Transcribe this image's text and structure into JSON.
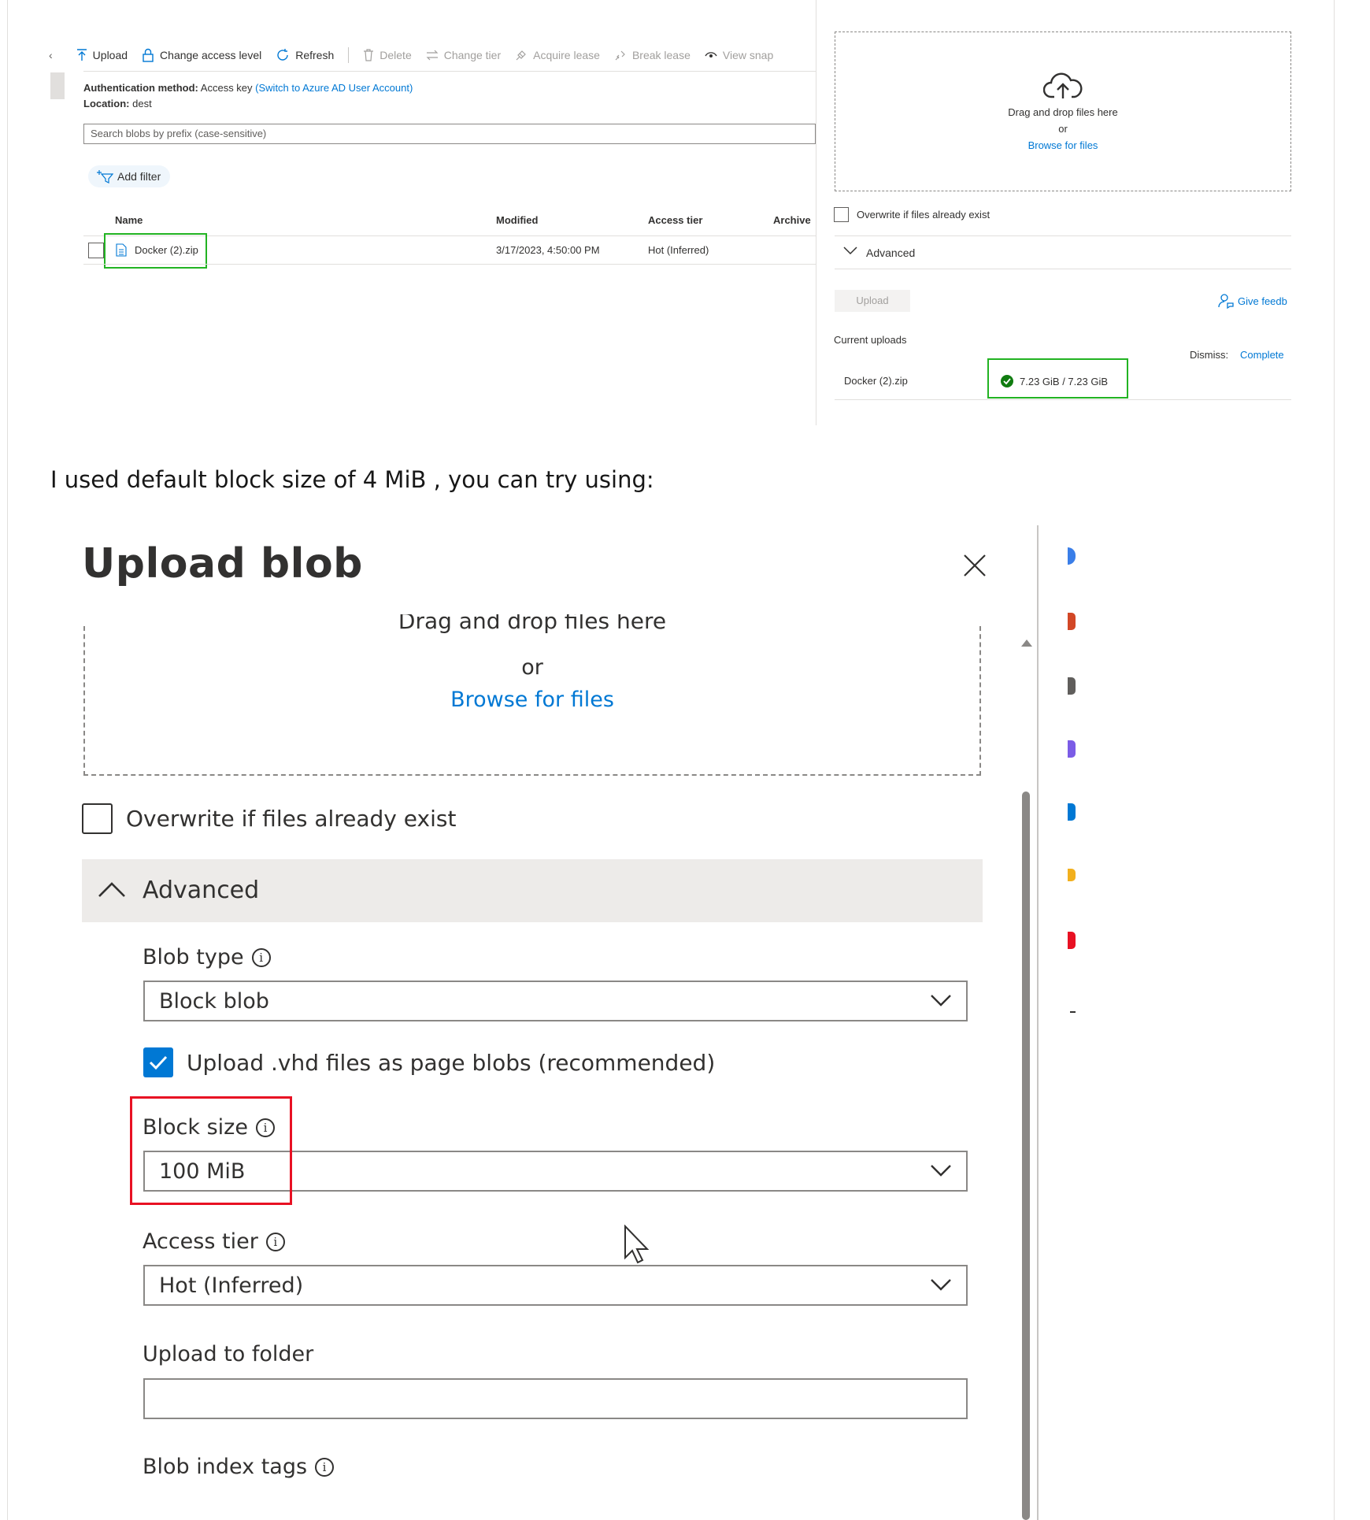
{
  "top_screenshot": {
    "toolbar": {
      "collapse": "‹",
      "upload": "Upload",
      "change_access_level": "Change access level",
      "refresh": "Refresh",
      "delete": "Delete",
      "change_tier": "Change tier",
      "acquire_lease": "Acquire lease",
      "break_lease": "Break lease",
      "view_snapshots": "View snap"
    },
    "auth": {
      "method_label": "Authentication method:",
      "method_value": "Access key",
      "switch_link": "(Switch to Azure AD User Account)",
      "location_label": "Location:",
      "location_value": "dest"
    },
    "search_placeholder": "Search blobs by prefix (case-sensitive)",
    "add_filter": "Add filter",
    "table": {
      "headers": [
        "Name",
        "Modified",
        "Access tier",
        "Archive"
      ],
      "rows": [
        {
          "name": "Docker (2).zip",
          "modified": "3/17/2023, 4:50:00 PM",
          "access_tier": "Hot (Inferred)"
        }
      ]
    },
    "upload_panel": {
      "drag_drop": "Drag and drop files here",
      "or": "or",
      "browse": "Browse for files",
      "overwrite": "Overwrite if files already exist",
      "advanced": "Advanced",
      "upload_button": "Upload",
      "give_feedback": "Give feedb",
      "current_uploads": "Current uploads",
      "dismiss_label": "Dismiss:",
      "dismiss_completed": "Complete",
      "upload_item": {
        "name": "Docker (2).zip",
        "progress": "7.23 GiB / 7.23 GiB"
      }
    }
  },
  "body_text": "I used default block size of 4 MiB , you can try using:",
  "dialog": {
    "title": "Upload blob",
    "close": "×",
    "drag_drop": "Drag and drop files here",
    "or": "or",
    "browse": "Browse for files",
    "overwrite": "Overwrite if files already exist",
    "advanced": "Advanced",
    "blob_type_label": "Blob type",
    "blob_type_value": "Block blob",
    "vhd_checkbox": "Upload .vhd files as page blobs (recommended)",
    "block_size_label": "Block size",
    "block_size_value": "100 MiB",
    "access_tier_label": "Access tier",
    "access_tier_value": "Hot (Inferred)",
    "upload_folder_label": "Upload to folder",
    "upload_folder_value": "",
    "blob_index_tags_label": "Blob index tags"
  },
  "colors": {
    "accent": "#0078d4",
    "highlight_green": "#22b322",
    "highlight_red": "#e81123",
    "checkbox_checked": "#0078d4",
    "success": "#107c10"
  }
}
